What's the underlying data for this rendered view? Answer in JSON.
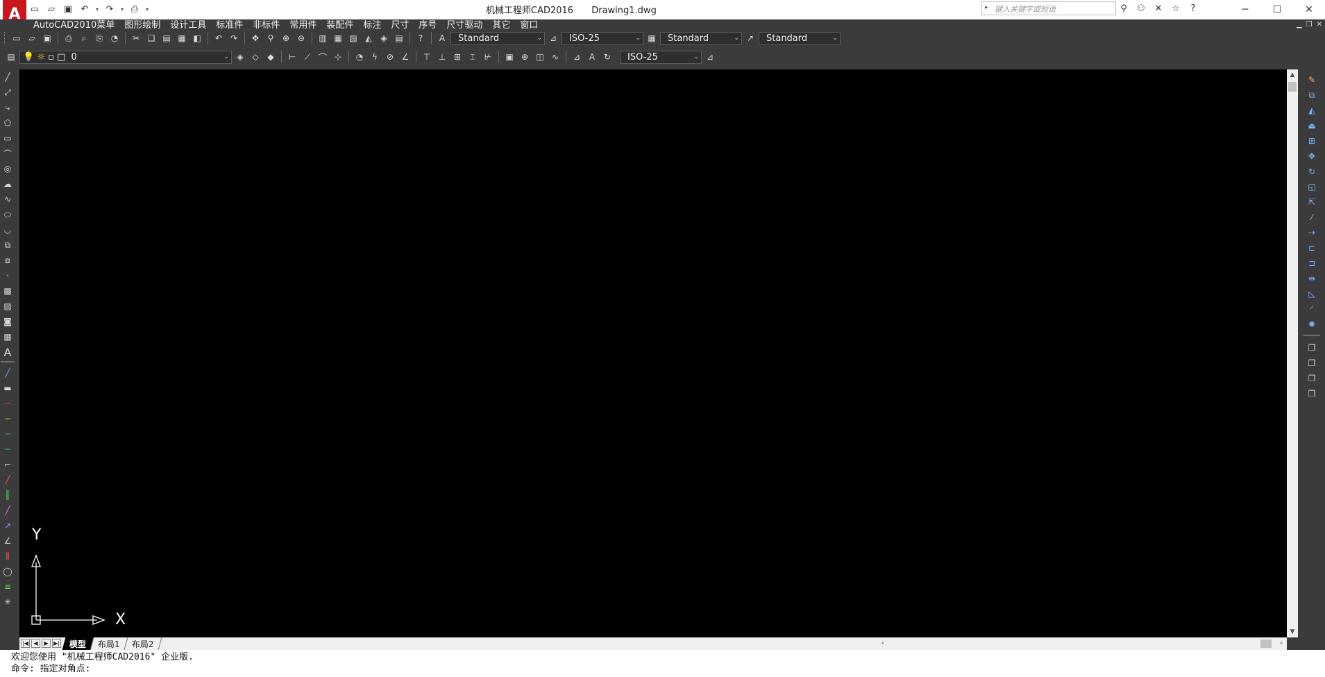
{
  "titlebar": {
    "app_name": "机械工程师CAD2016",
    "document": "Drawing1.dwg",
    "search_placeholder": "键入关键字或短语"
  },
  "menu": [
    "AutoCAD2010菜单",
    "图形绘制",
    "设计工具",
    "标准件",
    "非标件",
    "常用件",
    "装配件",
    "标注",
    "尺寸",
    "序号",
    "尺寸驱动",
    "其它",
    "窗口"
  ],
  "toolbar1": {
    "text_style": "Standard",
    "dim_style": "ISO-25",
    "table_style": "Standard",
    "multileader_style": "Standard"
  },
  "toolbar2": {
    "layer": "0",
    "dim_style": "ISO-25"
  },
  "ucs": {
    "x_label": "X",
    "y_label": "Y"
  },
  "layout_tabs": [
    "模型",
    "布局1",
    "布局2"
  ],
  "command_window": {
    "line1": "欢迎您使用 \"机械工程师CAD2016\" 企业版.",
    "line2": "命令: 指定对角点:"
  },
  "colors": {
    "canvas": "#000000",
    "ui_dark": "#3b3b3b",
    "accent_red": "#d42b2b"
  }
}
